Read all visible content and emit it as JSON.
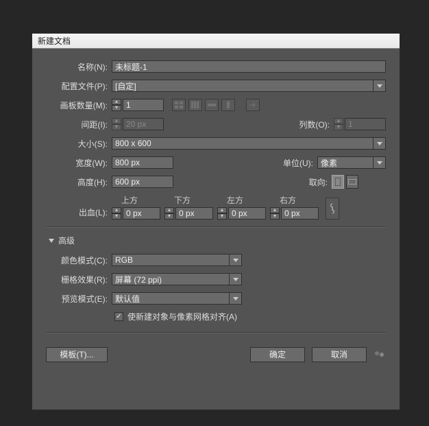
{
  "dialog": {
    "title": "新建文档"
  },
  "name": {
    "label": "名称(N):",
    "value": "未标题-1"
  },
  "profile": {
    "label": "配置文件(P):",
    "value": "[自定]"
  },
  "artboards": {
    "label": "画板数量(M):",
    "value": "1"
  },
  "spacing": {
    "label": "间距(I):",
    "value": "20 px"
  },
  "cols": {
    "label": "列数(O):",
    "value": "1"
  },
  "size": {
    "label": "大小(S):",
    "value": "800 x 600"
  },
  "width": {
    "label": "宽度(W):",
    "value": "800 px"
  },
  "height": {
    "label": "高度(H):",
    "value": "600 px"
  },
  "units": {
    "label": "单位(U):",
    "value": "像素"
  },
  "orient": {
    "label": "取向:"
  },
  "bleed": {
    "label": "出血(L):",
    "top": {
      "label": "上方",
      "value": "0 px"
    },
    "bottom": {
      "label": "下方",
      "value": "0 px"
    },
    "left": {
      "label": "左方",
      "value": "0 px"
    },
    "right": {
      "label": "右方",
      "value": "0 px"
    }
  },
  "advanced": {
    "label": "高级"
  },
  "colorMode": {
    "label": "颜色模式(C):",
    "value": "RGB"
  },
  "raster": {
    "label": "栅格效果(R):",
    "value": "屏幕 (72 ppi)"
  },
  "preview": {
    "label": "预览模式(E):",
    "value": "默认值"
  },
  "align": {
    "label": "使新建对象与像素网格对齐(A)"
  },
  "buttons": {
    "template": "模板(T)...",
    "ok": "确定",
    "cancel": "取消"
  }
}
